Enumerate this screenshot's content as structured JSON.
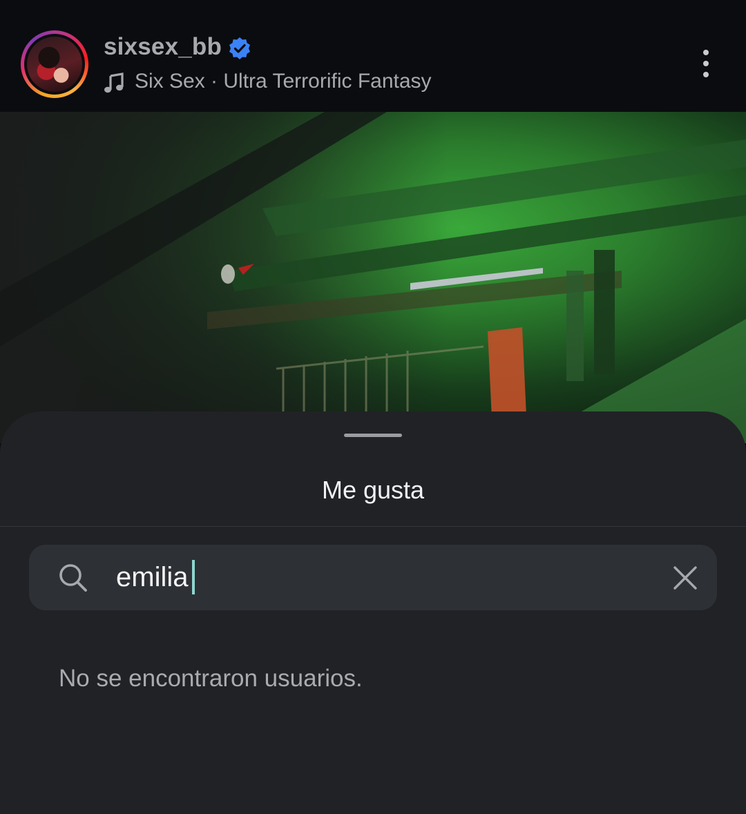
{
  "header": {
    "username": "sixsex_bb",
    "song": "Six Sex · Ultra Terrorific Fantasy",
    "avatar_icon": "avatar-photo",
    "verified_icon": "verified-badge-icon",
    "music_icon": "music-note-icon",
    "more_icon": "more-vertical-icon"
  },
  "sheet": {
    "title": "Me gusta",
    "search": {
      "value": "emilia",
      "search_icon": "search-icon",
      "clear_icon": "close-icon"
    },
    "empty_message": "No se encontraron usuarios."
  },
  "colors": {
    "background": "#0b0c0f",
    "sheet": "#212226",
    "search_field": "#2d3035",
    "verified": "#3b82f6",
    "caret": "#8fd6cf"
  }
}
